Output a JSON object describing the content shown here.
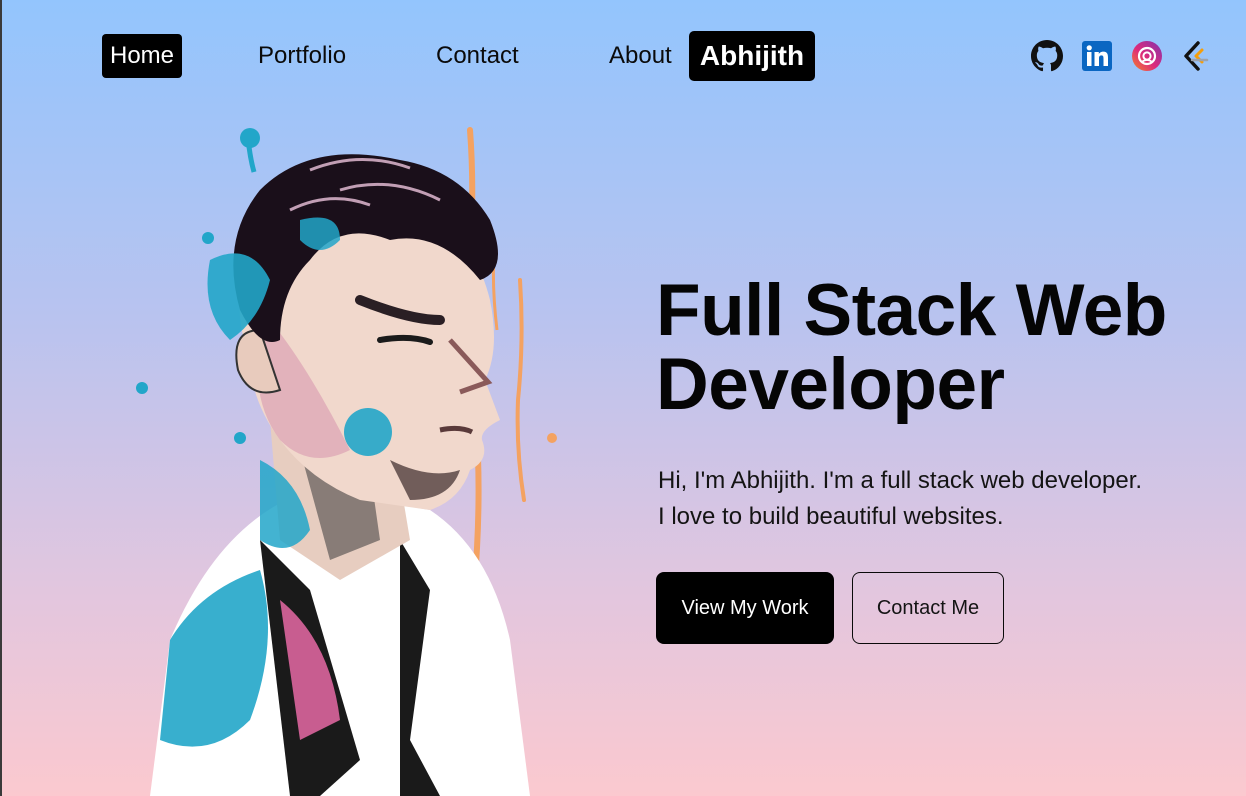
{
  "nav": {
    "links": [
      {
        "label": "Home"
      },
      {
        "label": "Portfolio"
      },
      {
        "label": "Contact"
      },
      {
        "label": "About"
      }
    ],
    "brand": "Abhijith",
    "socials": [
      {
        "icon": "github-icon"
      },
      {
        "icon": "linkedin-icon"
      },
      {
        "icon": "instagram-icon"
      },
      {
        "icon": "code-icon"
      }
    ]
  },
  "hero": {
    "title": "Full Stack Web Developer",
    "intro_line1": "Hi, I'm Abhijith. I'm a full stack web developer.",
    "intro_line2": "I love to build beautiful websites.",
    "primary_button": "View My Work",
    "secondary_button": "Contact Me"
  },
  "colors": {
    "gradient_top": "#93c5fd",
    "gradient_bottom": "#fbc9cf",
    "accent_dark": "#000000",
    "linkedin_blue": "#0a66c2"
  }
}
